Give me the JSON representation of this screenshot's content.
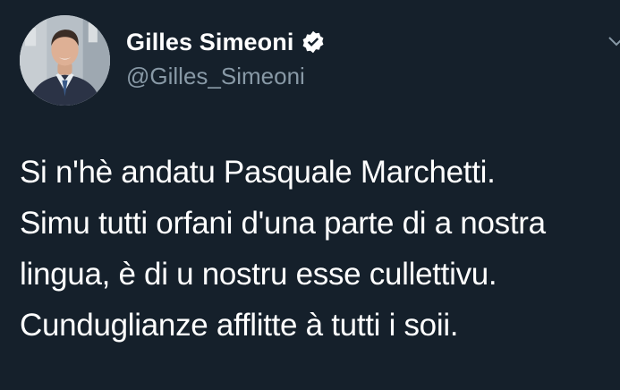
{
  "author": {
    "display_name": "Gilles Simeoni",
    "handle": "@Gilles_Simeoni",
    "verified": true,
    "avatar": "profile-photo"
  },
  "tweet": {
    "lines": [
      "Si n'hè andatu Pasquale Marchetti.",
      "Simu tutti orfani d'una parte di a nostra",
      "lingua, è di u nostru esse cullettivu.",
      "Cunduglianze afflitte à tutti i soii."
    ]
  },
  "icons": {
    "verified": "verified-badge-icon",
    "menu": "chevron-down-icon"
  },
  "colors": {
    "background": "#15202b",
    "text": "#ffffff",
    "handle": "#8899a6"
  }
}
